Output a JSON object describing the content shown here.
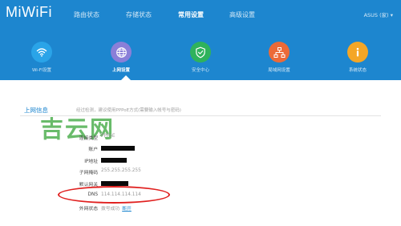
{
  "header": {
    "logo": "MiWiFi",
    "nav": [
      {
        "label": "路由状态",
        "active": false
      },
      {
        "label": "存储状态",
        "active": false
      },
      {
        "label": "常用设置",
        "active": true
      },
      {
        "label": "高级设置",
        "active": false
      }
    ],
    "user": "ASUS (家) ▾"
  },
  "settings_icons": [
    {
      "label": "Wi-Fi设置",
      "icon": "wifi-icon",
      "color": "#2aa4e8",
      "active": false
    },
    {
      "label": "上网设置",
      "icon": "globe-icon",
      "color": "#8a7fd8",
      "active": true
    },
    {
      "label": "安全中心",
      "icon": "shield-icon",
      "color": "#2fb25c",
      "active": false
    },
    {
      "label": "局域网设置",
      "icon": "network-icon",
      "color": "#ec6a38",
      "active": false
    },
    {
      "label": "系统状态",
      "icon": "info-icon",
      "color": "#f4a626",
      "active": false
    }
  ],
  "section": {
    "title": "上网信息",
    "hint": "经过检测，建议使用PPPoE方式(需要输入帐号与密码)"
  },
  "watermark": "吉云网",
  "info": {
    "conn_type_label": "连接类型",
    "conn_type_value": "PPPoE",
    "account_label": "账户",
    "ip_label": "IP地址",
    "subnet_label": "子网掩码",
    "subnet_value": "255.255.255.255",
    "gateway_label": "默认网关",
    "dns_label": "DNS",
    "dns_value": "114.114.114.114",
    "wan_status_label": "外网状态",
    "wan_status_value": "拨号成功",
    "disconnect_link": "断开"
  },
  "colors": {
    "header_bg": "#1d86cf",
    "accent": "#1d86cf",
    "highlight_ellipse": "#e0201f",
    "watermark": "#4fb051"
  }
}
